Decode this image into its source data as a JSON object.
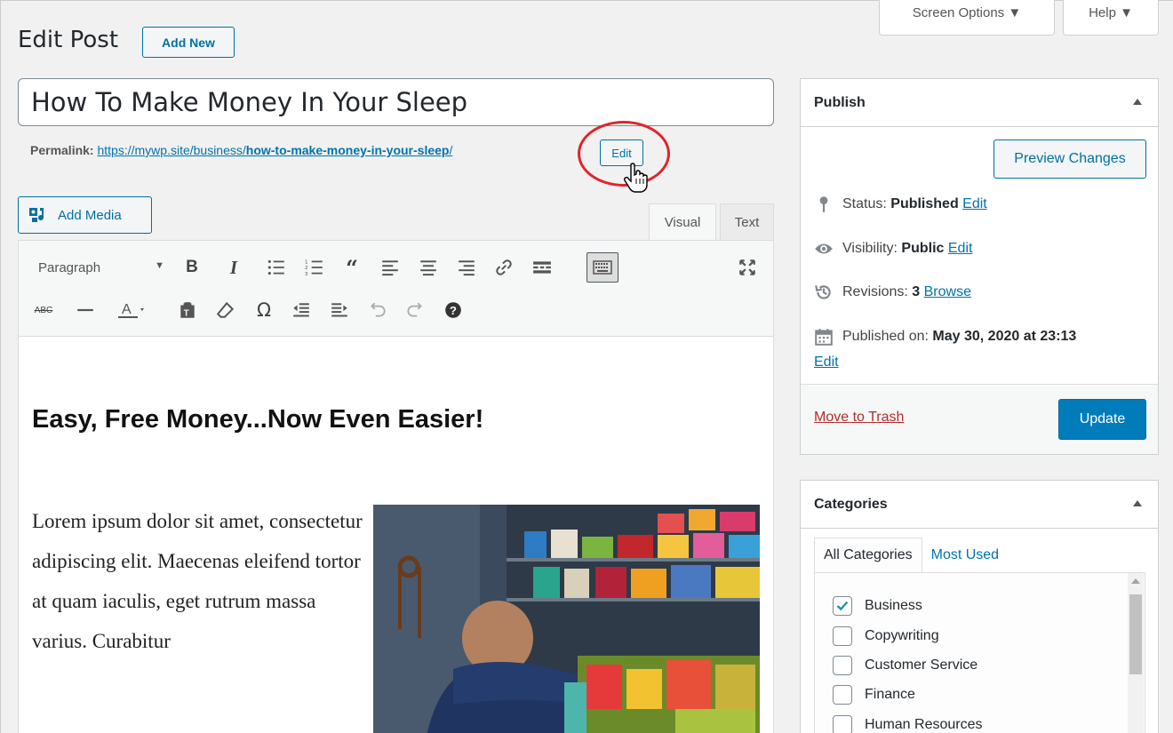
{
  "top_tabs": {
    "screen_options": "Screen Options ▼",
    "help": "Help ▼"
  },
  "header": {
    "title": "Edit Post",
    "add_new": "Add New"
  },
  "post": {
    "title": "How To Make Money In Your Sleep",
    "permalink_label": "Permalink:",
    "permalink_base": "https://mywp.site/business/",
    "permalink_slug": "how-to-make-money-in-your-sleep",
    "permalink_end": "/",
    "permalink_edit": "Edit"
  },
  "editor": {
    "add_media": "Add Media",
    "tabs": {
      "visual": "Visual",
      "text": "Text"
    },
    "format_select": "Paragraph",
    "content_heading": "Easy, Free Money...Now Even Easier!",
    "content_paragraph": "Lorem ipsum dolor sit amet, consectetur adipiscing elit. Maecenas eleifend tortor at quam iaculis, eget rutrum massa varius. Curabitur",
    "toolbar_row1": [
      "bold",
      "italic",
      "bulleted-list",
      "numbered-list",
      "blockquote",
      "align-left",
      "align-center",
      "align-right",
      "insert-link",
      "read-more",
      "toolbar-toggle",
      "fullscreen"
    ],
    "toolbar_row2": [
      "strikethrough",
      "horizontal-line",
      "text-color",
      "paste-as-text",
      "clear-formatting",
      "special-character",
      "decrease-indent",
      "increase-indent",
      "undo",
      "redo",
      "keyboard-shortcuts"
    ]
  },
  "publish": {
    "title": "Publish",
    "preview": "Preview Changes",
    "status_label": "Status:",
    "status_value": "Published",
    "visibility_label": "Visibility:",
    "visibility_value": "Public",
    "revisions_label": "Revisions:",
    "revisions_value": "3",
    "revisions_link": "Browse",
    "published_label": "Published on:",
    "published_value": "May 30, 2020 at 23:13",
    "edit": "Edit",
    "trash": "Move to Trash",
    "update": "Update"
  },
  "categories": {
    "title": "Categories",
    "tab_all": "All Categories",
    "tab_most_used": "Most Used",
    "items": [
      {
        "label": "Business",
        "checked": true
      },
      {
        "label": "Copywriting",
        "checked": false
      },
      {
        "label": "Customer Service",
        "checked": false
      },
      {
        "label": "Finance",
        "checked": false
      },
      {
        "label": "Human Resources",
        "checked": false
      }
    ]
  },
  "colors": {
    "accent": "#0071a1",
    "primary_button": "#007cba",
    "trash": "#b32d2e",
    "annotation_circle": "#e0242a"
  }
}
